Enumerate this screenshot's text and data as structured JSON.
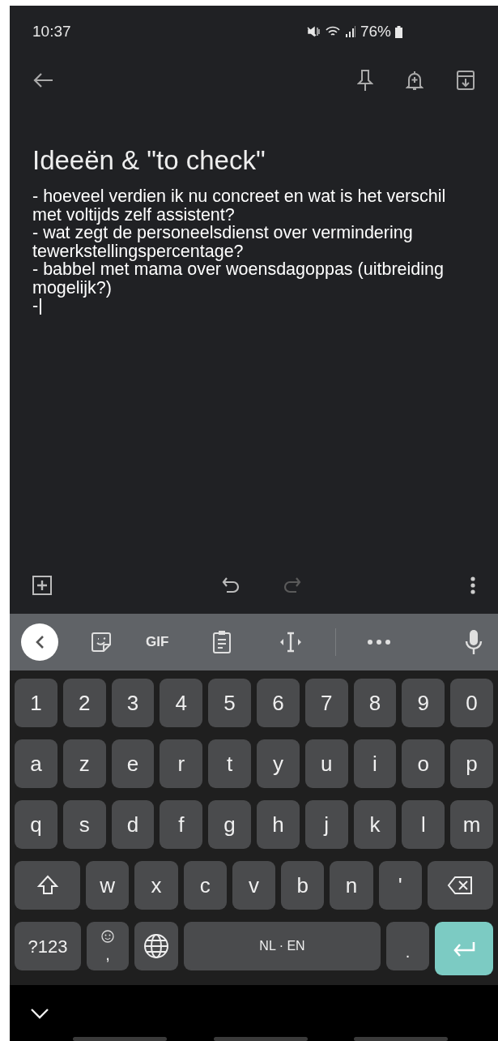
{
  "status_bar": {
    "time": "10:37",
    "battery": "76%"
  },
  "note": {
    "title": "Ideeën & \"to check\"",
    "lines": [
      "- hoeveel verdien ik nu concreet en wat is het verschil met voltijds zelf assistent?",
      "- wat zegt de personeelsdienst over vermindering tewerkstellingspercentage?",
      "- babbel met mama over woensdagoppas (uitbreiding mogelijk?)",
      "-"
    ]
  },
  "editor_toolbar": {
    "undo": {
      "disabled": false
    },
    "redo": {
      "disabled": true
    }
  },
  "keyboard": {
    "suggestion_bar": {
      "gif": "GIF"
    },
    "number_row": [
      {
        "kind": "char",
        "label": "1"
      },
      {
        "kind": "char",
        "label": "2"
      },
      {
        "kind": "char",
        "label": "3"
      },
      {
        "kind": "char",
        "label": "4"
      },
      {
        "kind": "char",
        "label": "5"
      },
      {
        "kind": "char",
        "label": "6"
      },
      {
        "kind": "char",
        "label": "7"
      },
      {
        "kind": "char",
        "label": "8"
      },
      {
        "kind": "char",
        "label": "9"
      },
      {
        "kind": "char",
        "label": "0"
      }
    ],
    "top_letter_row": [
      {
        "kind": "char",
        "label": "a"
      },
      {
        "kind": "char",
        "label": "z"
      },
      {
        "kind": "char",
        "label": "e"
      },
      {
        "kind": "char",
        "label": "r"
      },
      {
        "kind": "char",
        "label": "t"
      },
      {
        "kind": "char",
        "label": "y"
      },
      {
        "kind": "char",
        "label": "u"
      },
      {
        "kind": "char",
        "label": "i"
      },
      {
        "kind": "char",
        "label": "o"
      },
      {
        "kind": "char",
        "label": "p"
      }
    ],
    "middle_letter_row": [
      {
        "kind": "char",
        "label": "q"
      },
      {
        "kind": "char",
        "label": "s"
      },
      {
        "kind": "char",
        "label": "d"
      },
      {
        "kind": "char",
        "label": "f"
      },
      {
        "kind": "char",
        "label": "g"
      },
      {
        "kind": "char",
        "label": "h"
      },
      {
        "kind": "char",
        "label": "j"
      },
      {
        "kind": "char",
        "label": "k"
      },
      {
        "kind": "char",
        "label": "l"
      },
      {
        "kind": "char",
        "label": "m"
      }
    ],
    "bottom_letter_row": [
      {
        "kind": "shift"
      },
      {
        "kind": "char",
        "label": "w"
      },
      {
        "kind": "char",
        "label": "x"
      },
      {
        "kind": "char",
        "label": "c"
      },
      {
        "kind": "char",
        "label": "v"
      },
      {
        "kind": "char",
        "label": "b"
      },
      {
        "kind": "char",
        "label": "n"
      },
      {
        "kind": "char",
        "label": "'"
      },
      {
        "kind": "backspace"
      }
    ],
    "function_row": [
      {
        "kind": "symbols",
        "label": "?123"
      },
      {
        "kind": "emoji_comma",
        "label": ","
      },
      {
        "kind": "globe"
      },
      {
        "kind": "space",
        "label": "NL · EN"
      },
      {
        "kind": "period",
        "label": "."
      },
      {
        "kind": "enter"
      }
    ]
  }
}
